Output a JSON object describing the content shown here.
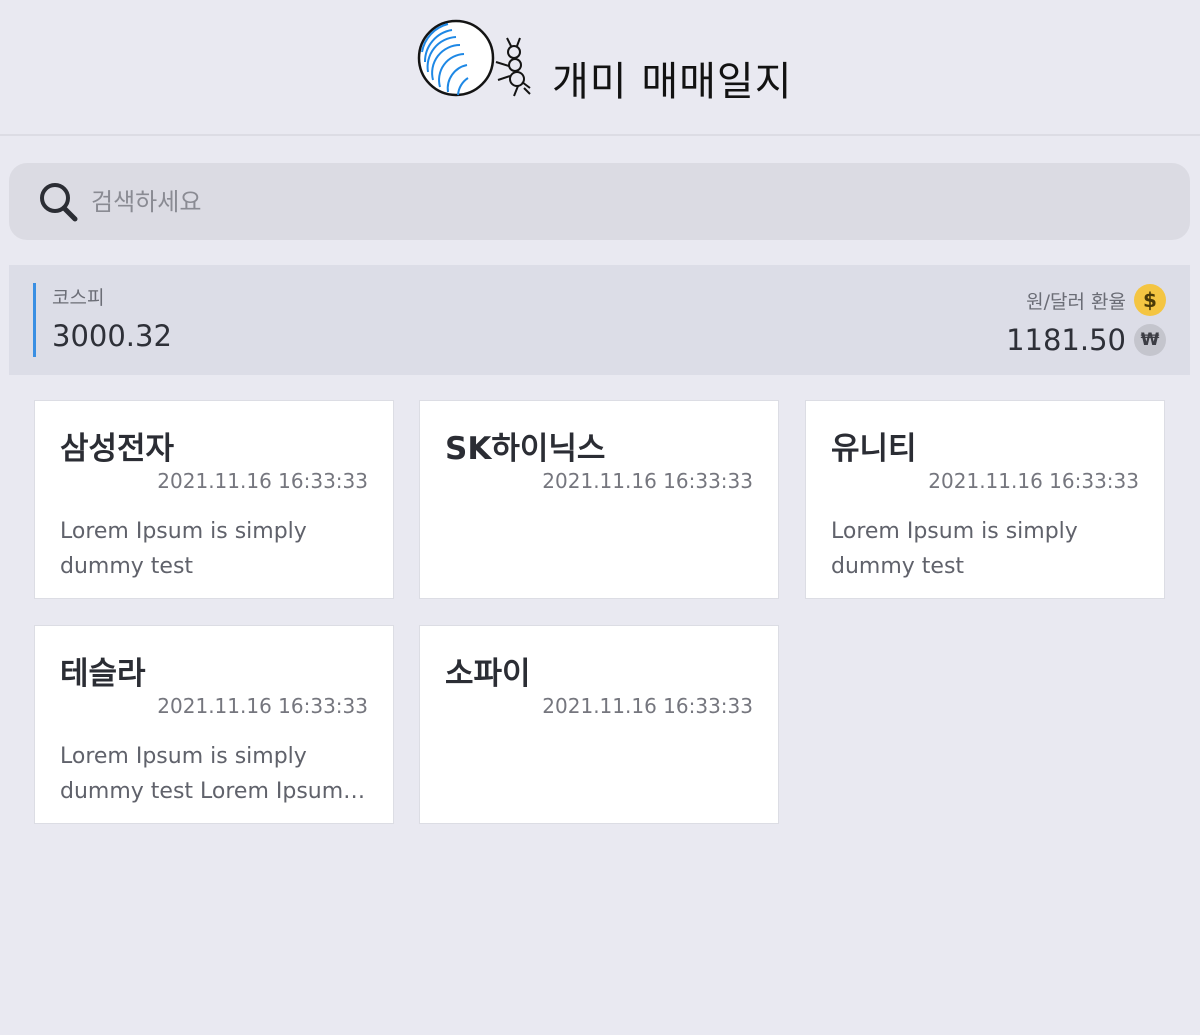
{
  "header": {
    "title": "개미 매매일지"
  },
  "search": {
    "placeholder": "검색하세요",
    "value": ""
  },
  "market": {
    "kospi_label": "코스피",
    "kospi_value": "3000.32",
    "fx_label": "원/달러 환율",
    "fx_value": "1181.50",
    "dollar_symbol": "$",
    "won_symbol": "₩"
  },
  "cards": [
    {
      "title": "삼성전자",
      "date": "2021.11.16 16:33:33",
      "body": "Lorem Ipsum is simply dummy test"
    },
    {
      "title": "SK하이닉스",
      "date": "2021.11.16 16:33:33",
      "body": ""
    },
    {
      "title": "유니티",
      "date": "2021.11.16 16:33:33",
      "body": "Lorem Ipsum is simply dummy test"
    },
    {
      "title": "테슬라",
      "date": "2021.11.16 16:33:33",
      "body": "Lorem Ipsum is simply dummy test Lorem Ipsum is simply dummy test"
    },
    {
      "title": "소파이",
      "date": "2021.11.16 16:33:33",
      "body": ""
    }
  ],
  "colors": {
    "background": "#e9e9f1",
    "accent": "#3a8fe3",
    "dollar_badge": "#f4c542"
  }
}
